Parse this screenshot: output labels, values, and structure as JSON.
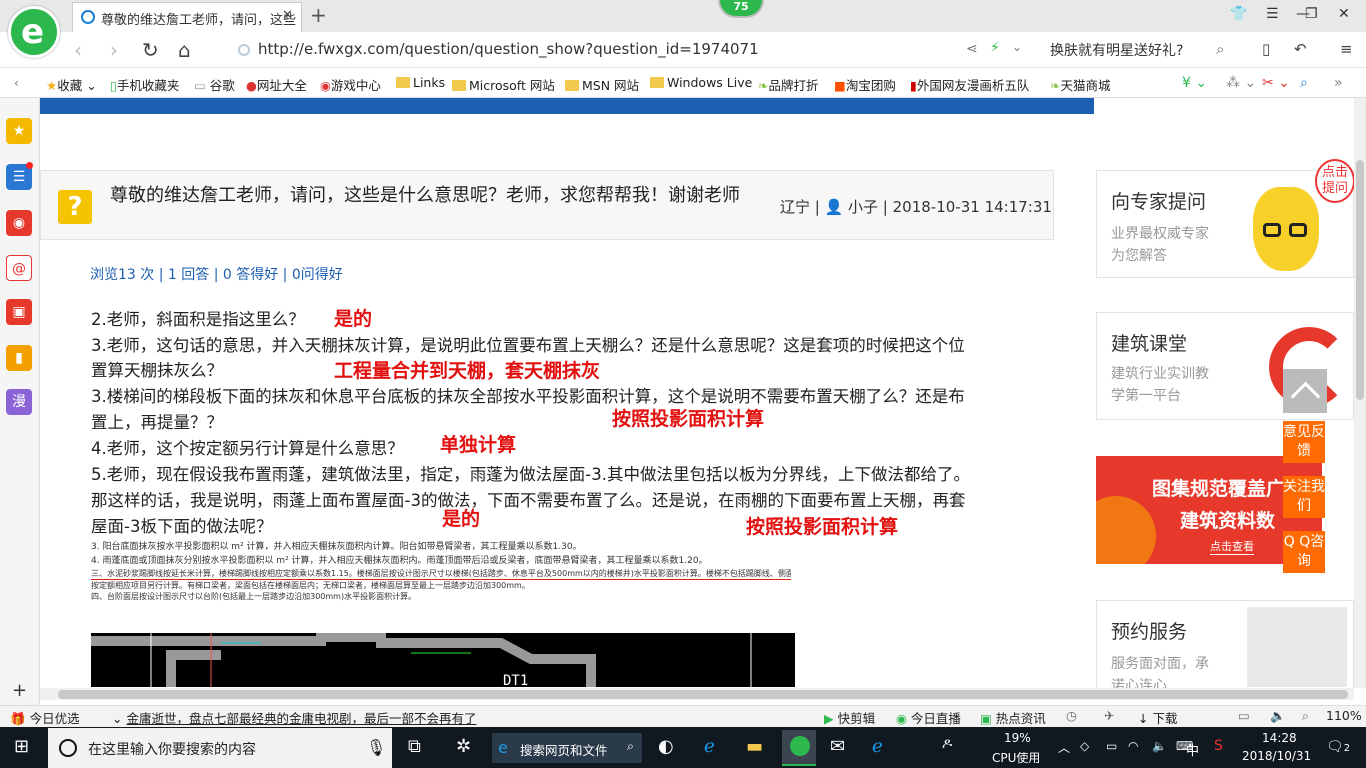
{
  "browser": {
    "tab_title": "尊敬的维达詹工老师，请问，这些",
    "badge": "75",
    "url": "http://e.fwxgx.com/question/question_show?question_id=1974071",
    "search_text": "换肤就有明星送好礼?",
    "bookmarks": [
      "收藏",
      "手机收藏夹",
      "谷歌",
      "网址大全",
      "游戏中心",
      "Links",
      "Microsoft 网站",
      "MSN 网站",
      "Windows Live",
      "品牌打折",
      "淘宝团购",
      "外国网友漫画析五队",
      "天猫商城"
    ]
  },
  "sidebar": {
    "manga_label": "漫"
  },
  "question": {
    "title": "尊敬的维达詹工老师，请问，这些是什么意思呢？老师，求您帮帮我！谢谢老师",
    "meta": "辽宁 | 👤 小子 | 2018-10-31 14:17:31",
    "stats": "浏览13 次 | 1 回答 | 0 答得好 | 0问得好",
    "lines": [
      "2.老师，斜面积是指这里么？",
      "3.老师，这句话的意思，并入天棚抹灰计算，是说明此位置要布置上天棚么？还是什么意思呢？这是套项的时候把这个位",
      "置算天棚抹灰么？",
      "3.楼梯间的梯段板下面的抹灰和休息平台底板的抹灰全部按水平投影面积计算，这个是说明不需要布置天棚了么？还是布",
      "置上，再提量？？",
      "4.老师，这个按定额另行计算是什么意思？",
      "5.老师，现在假设我布置雨蓬，建筑做法里，指定，雨蓬为做法屋面-3.其中做法里包括以板为分界线，上下做法都给了。",
      "那这样的话，我是说明，雨蓬上面布置屋面-3的做法，下面不需要布置了么。还是说，在雨棚的下面要布置上天棚，再套",
      "屋面-3板下面的做法呢？"
    ],
    "answers": {
      "a1": "是的",
      "a2": "工程量合并到天棚，套天棚抹灰",
      "a3": "按照投影面积计算",
      "a4": "单独计算",
      "a5": "是的",
      "a6": "按照投影面积计算"
    },
    "doc_lines": [
      "3. 阳台底面抹灰按水平投影面积以 m² 计算，并入相应天棚抹灰面积内计算。阳台如带悬臂梁者，其工程量乘以系数1.30。",
      "4. 雨蓬底面或顶面抹灰分别按水平投影面积以 m² 计算，并入相应天棚抹灰面积内。雨蓬顶面带后沿或反梁者，底面带悬臂梁者，其工程量乘以系数1.20。",
      "三、水泥砂浆踢脚线按延长米计算，楼梯踢脚线按相应定额乘以系数1.15。楼梯面层按设计图示尺寸以楼梯(包括踏步、休息平台及500mm以内的楼梯井)水平投影面积计算。楼梯不包括踢脚线、侧面及板底抹灰，其工程量",
      "按定额相应项目另行计算。有梯口梁者，梁面包括在楼梯面层内；无梯口梁者，楼梯面层算至最上一层踏步边沿加300mm。",
      "四、台阶面层按设计图示尺寸以台阶(包括最上一层踏步边沿加300mm)水平投影面积计算。"
    ],
    "cad_label": "DT1"
  },
  "right": {
    "expert_title": "向专家提问",
    "expert_sub1": "业界最权威专家",
    "expert_sub2": "为您解答",
    "expert_bubble": "点击提问",
    "class_title": "建筑课堂",
    "class_sub1": "建筑行业实训教",
    "class_sub2": "学第一平台",
    "ad_line1": "图集规范覆盖广",
    "ad_line2": "建筑资料数",
    "ad_btn": "点击查看",
    "booking_title": "预约服务",
    "booking_sub1": "服务面对面，承",
    "booking_sub2": "诺心连心",
    "feedback": "意见反馈",
    "follow": "关注我们",
    "qq": "Q Q咨询"
  },
  "statusbar": {
    "today": "今日优选",
    "news": "金庸逝世，盘点七部最经典的金庸电视剧，最后一部不会再有了",
    "kuaijian": "快剪辑",
    "live": "今日直播",
    "hot": "热点资讯",
    "download": "下载",
    "zoom": "110%"
  },
  "taskbar": {
    "search_placeholder": "在这里输入你要搜索的内容",
    "web_search": "搜索网页和文件",
    "cpu_percent": "19%",
    "cpu_label": "CPU使用",
    "ime": "中",
    "time": "14:28",
    "date": "2018/10/31",
    "notifications": "2"
  }
}
